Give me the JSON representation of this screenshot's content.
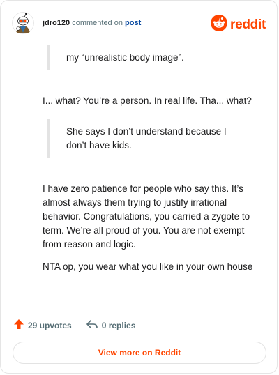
{
  "comment": {
    "username": "jdro120",
    "action_text": "commented on",
    "post_link": "post",
    "avatar": "snoo-avatar-icon"
  },
  "brand": {
    "icon": "reddit-snoo-icon",
    "wordmark": "reddit",
    "color": "#ff4500"
  },
  "body": {
    "quote1": "my “unrealistic body image”.",
    "para1": "I... what? You’re a person. In real life. Tha... what?",
    "quote2": "She says I don’t understand because I don’t have kids.",
    "para2": "I have zero patience for people who say this. It’s almost always them trying to justify irrational behavior. Congratulations, you carried a zygote to term. We’re all proud of you. You are not exempt from reason and logic.",
    "para3": "NTA op, you wear what you like in your own house"
  },
  "footer": {
    "upvotes": "29 upvotes",
    "upvote_icon": "upvote-arrow-icon",
    "replies": "0 replies",
    "reply_icon": "reply-arrow-icon"
  },
  "cta": {
    "view_more": "View more on Reddit"
  },
  "colors": {
    "accent": "#ff4500",
    "link": "#0a4aa0",
    "meta": "#576f76"
  }
}
